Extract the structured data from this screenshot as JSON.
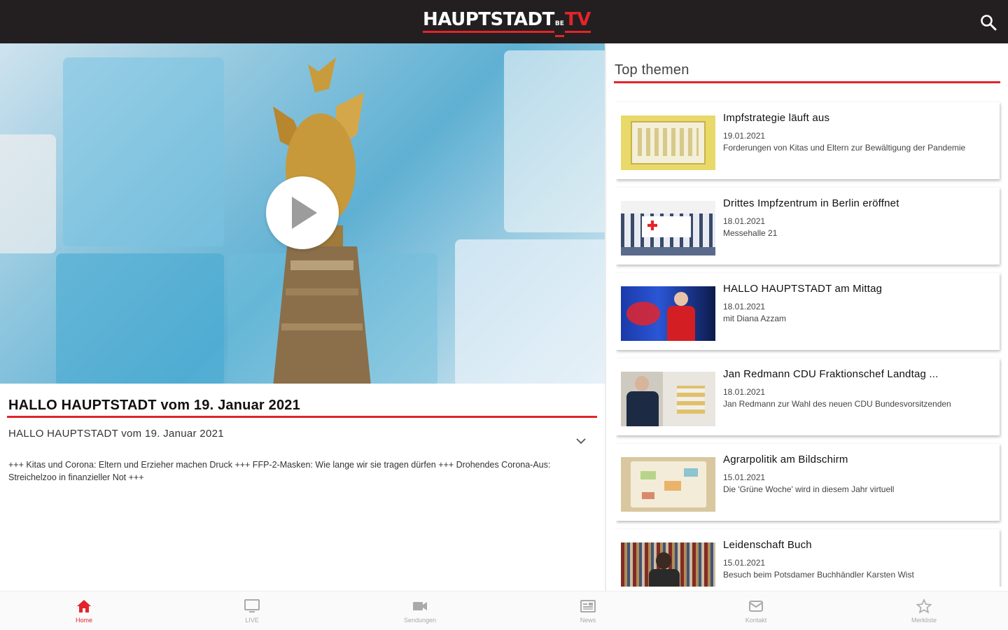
{
  "app": {
    "logo_main": "HAUPTSTADT",
    "logo_sub": "BE",
    "logo_tv": "TV",
    "accent": "#e3242b",
    "topbar_bg": "#231f20"
  },
  "featured": {
    "title": "HALLO HAUPTSTADT vom 19. Januar 2021",
    "subtitle": "HALLO HAUPTSTADT vom 19. Januar 2021",
    "description": "+++ Kitas und Corona: Eltern und Erzieher machen Druck +++ FFP-2-Masken: Wie lange wir sie tragen dürfen +++ Drohendes Corona-Aus: Streichelzoo in finanzieller Not +++"
  },
  "top_themen": {
    "heading": "Top themen",
    "items": [
      {
        "title": "Impfstrategie läuft aus",
        "date": "19.01.2021",
        "desc": "Forderungen von Kitas und Eltern zur Bewältigung der Pandemie"
      },
      {
        "title": "Drittes Impfzentrum in Berlin eröffnet",
        "date": "18.01.2021",
        "desc": "Messehalle 21"
      },
      {
        "title": "HALLO HAUPTSTADT am Mittag",
        "date": "18.01.2021",
        "desc": "mit Diana Azzam"
      },
      {
        "title": "Jan Redmann CDU Fraktionschef Landtag ...",
        "date": "18.01.2021",
        "desc": "Jan Redmann zur Wahl des neuen CDU Bundesvorsitzenden"
      },
      {
        "title": "Agrarpolitik am Bildschirm",
        "date": "15.01.2021",
        "desc": "Die 'Grüne Woche' wird in diesem Jahr virtuell"
      },
      {
        "title": "Leidenschaft Buch",
        "date": "15.01.2021",
        "desc": "Besuch beim Potsdamer Buchhändler Karsten Wist"
      }
    ]
  },
  "nav": {
    "home": "Home",
    "live": "LIVE",
    "sendungen": "Sendungen",
    "news": "News",
    "kontakt": "Kontakt",
    "merkliste": "Merkliste"
  },
  "icons": [
    "search-icon",
    "play-icon",
    "chevron-down-icon",
    "home-icon",
    "tv-icon",
    "video-camera-icon",
    "news-icon",
    "mail-icon",
    "star-icon"
  ]
}
